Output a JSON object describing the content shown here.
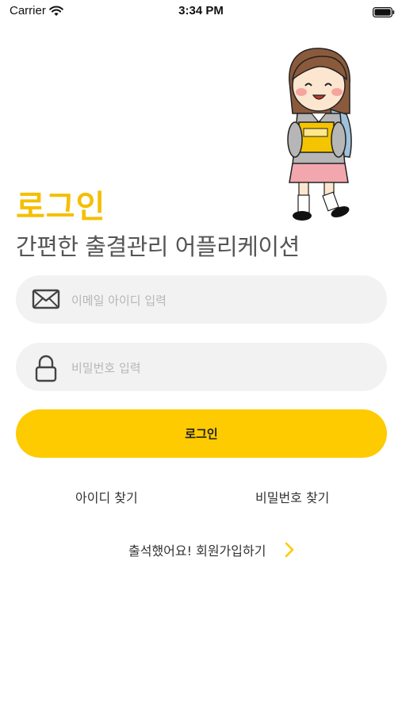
{
  "status_bar": {
    "carrier": "Carrier",
    "time": "3:34 PM",
    "icons": [
      "wifi-icon",
      "battery-icon"
    ]
  },
  "login": {
    "title": "로그인",
    "subtitle": "간편한 출결관리 어플리케이션",
    "email_placeholder": "이메일 아이디 입력",
    "email_value": "",
    "password_placeholder": "비밀번호 입력",
    "password_value": "",
    "submit_label": "로그인",
    "find_id_label": "아이디 찾기",
    "find_password_label": "비밀번호 찾기",
    "signup_label": "출석했어요! 회원가입하기"
  },
  "icons": {
    "email": "envelope-icon",
    "password": "lock-icon",
    "signup": "chevron-right-icon"
  },
  "colors": {
    "accent": "#fdcb00",
    "title": "#f5bf00",
    "field_bg": "#f2f2f2",
    "placeholder": "#b6b6b6"
  }
}
